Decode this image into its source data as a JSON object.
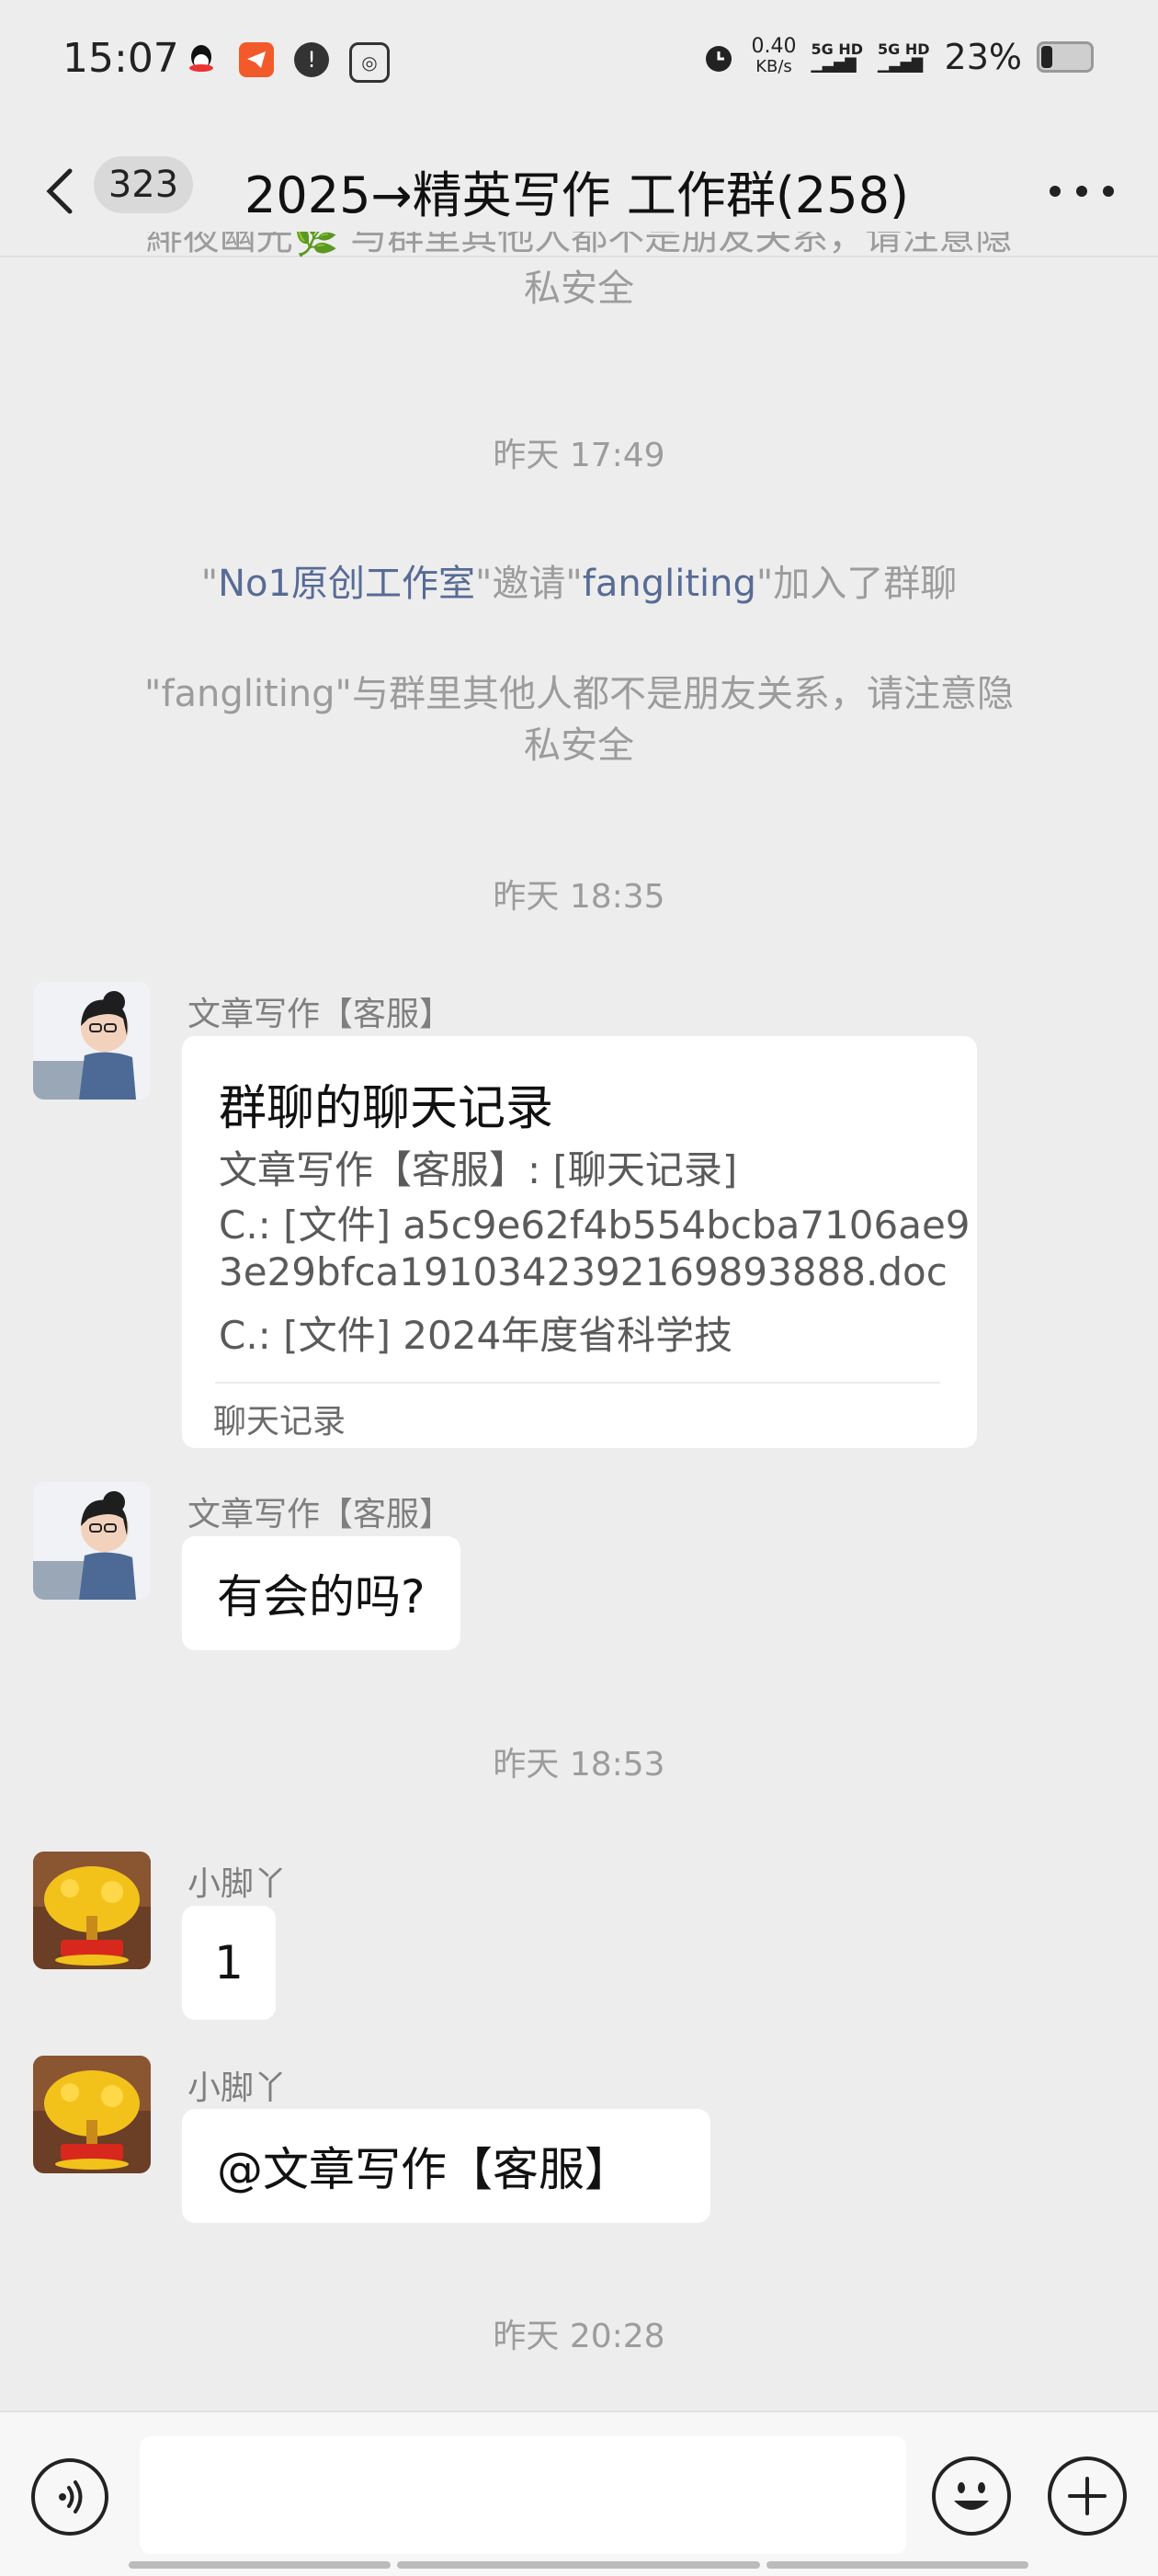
{
  "status_bar": {
    "time": "15:07",
    "net_speed_value": "0.40",
    "net_speed_unit": "KB/s",
    "sig1_label": "5G HD",
    "sig2_label": "5G HD",
    "battery": "23%",
    "icons": [
      "qq-icon",
      "telegram-icon",
      "alert-icon",
      "app-icon"
    ]
  },
  "header": {
    "unread_count": "323",
    "title": "2025→精英写作  工作群(258)"
  },
  "messages": {
    "sys_top": "\"fangliting\"与群里其他人都不是朋友关系，请注意隐私安全",
    "sys_top_line1": "緋夜幽光🌿 与群里其他人都不是朋友关系，请注意隐",
    "sys_top_line2": "私安全",
    "ts1": "昨天 17:49",
    "invite_part1": "\"",
    "invite_name1": "No1原创工作室",
    "invite_part2": "\"邀请\"",
    "invite_name2": "fangliting",
    "invite_part3": "\"加入了群聊",
    "privacy_line1": "\"fangliting\"与群里其他人都不是朋友关系，请注意隐",
    "privacy_line2": "私安全",
    "ts2": "昨天 18:35",
    "msg1_sender": "文章写作【客服】",
    "card_title": "群聊的聊天记录",
    "card_line1": "文章写作【客服】: [聊天记录]",
    "card_line2": "C.: [文件] a5c9e62f4b554bcba7106ae9",
    "card_line3": "3e29bfca1910342392169893888.doc",
    "card_line4": "C.: [文件] 2024年度省科学技",
    "card_footer": "聊天记录",
    "msg2_sender": "文章写作【客服】",
    "msg2_text": "有会的吗?",
    "ts3": "昨天 18:53",
    "msg3_sender": "小脚丫",
    "msg3_text": "1",
    "msg4_sender": "小脚丫",
    "msg4_text": "@文章写作【客服】",
    "ts4": "昨天 20:28"
  },
  "input_bar": {
    "placeholder": ""
  },
  "colors": {
    "background": "#ededed",
    "link_name": "#576b95",
    "system_text": "#9c9c9c"
  }
}
